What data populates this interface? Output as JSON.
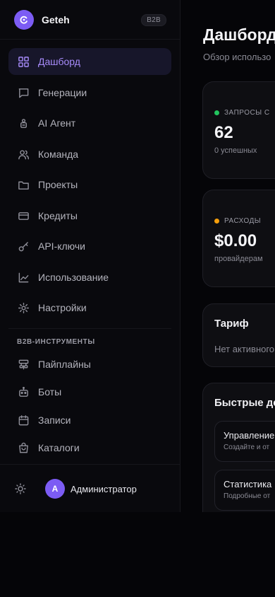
{
  "brand": {
    "name": "Geteh",
    "badge": "B2B"
  },
  "nav": [
    {
      "label": "Дашборд",
      "icon": "grid-icon",
      "active": true
    },
    {
      "label": "Генерации",
      "icon": "chat-icon"
    },
    {
      "label": "AI Агент",
      "icon": "robot-icon"
    },
    {
      "label": "Команда",
      "icon": "users-icon"
    },
    {
      "label": "Проекты",
      "icon": "folder-icon"
    },
    {
      "label": "Кредиты",
      "icon": "card-icon"
    },
    {
      "label": "API-ключи",
      "icon": "key-icon"
    },
    {
      "label": "Использование",
      "icon": "chart-icon"
    },
    {
      "label": "Настройки",
      "icon": "gear-icon"
    }
  ],
  "b2b_section": {
    "title": "B2B-ИНСТРУМЕНТЫ",
    "items": [
      {
        "label": "Пайплайны",
        "icon": "pipeline-icon"
      },
      {
        "label": "Боты",
        "icon": "bot-icon"
      },
      {
        "label": "Записи",
        "icon": "calendar-icon"
      },
      {
        "label": "Каталоги",
        "icon": "bag-icon"
      }
    ]
  },
  "user": {
    "initial": "A",
    "name": "Администратор"
  },
  "main": {
    "title": "Дашборд",
    "subtitle": "Обзор использо",
    "stats": [
      {
        "label": "ЗАПРОСЫ С",
        "value": "62",
        "sub": "0 успешных",
        "dot_color": "#22c55e"
      },
      {
        "label": "РАСХОДЫ",
        "value": "$0.00",
        "sub": "провайдерам",
        "dot_color": "#f59e0b"
      }
    ],
    "plan": {
      "title": "Тариф",
      "text": "Нет активного"
    },
    "quick": {
      "title": "Быстрые де",
      "actions": [
        {
          "title": "Управление",
          "sub": "Создайте и от"
        },
        {
          "title": "Статистика",
          "sub": "Подробные от"
        }
      ]
    }
  },
  "colors": {
    "accent": "#7c5cf4",
    "accent_text": "#a78bfa",
    "success": "#22c55e",
    "warning": "#f59e0b"
  }
}
